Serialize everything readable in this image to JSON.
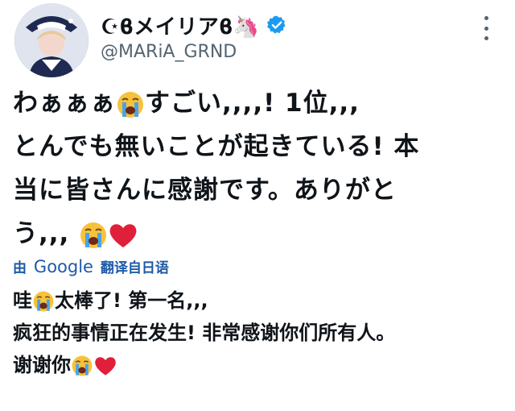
{
  "author": {
    "display_name": "☪︎ϐメイリアϐ🦄",
    "handle": "@MARiA_GRND"
  },
  "tweet": {
    "original_lines": [
      "わぁぁぁ",
      "すごい,,,,! 1位,,,",
      "とんでも無いことが起きている! 本",
      "当に皆さんに感謝です。ありがと",
      "う,,, "
    ],
    "translated_by": {
      "prefix": "由",
      "service": "Google",
      "suffix": "翻译自日语"
    },
    "translation_lines": [
      "哇",
      "太棒了! 第一名,,,",
      "疯狂的事情正在发生! 非常感谢你们所有人。",
      "谢谢你"
    ]
  },
  "colors": {
    "verified": "#1d9bf0",
    "link": "#1d5aa8",
    "handle": "#536471",
    "heart": "#e0203a",
    "emoji_face": "#f7c23b",
    "emoji_tear": "#4aa3e8"
  },
  "icons": [
    "avatar",
    "verified-badge-icon",
    "more-options-icon",
    "loudly-crying-face-emoji",
    "red-heart-emoji"
  ]
}
